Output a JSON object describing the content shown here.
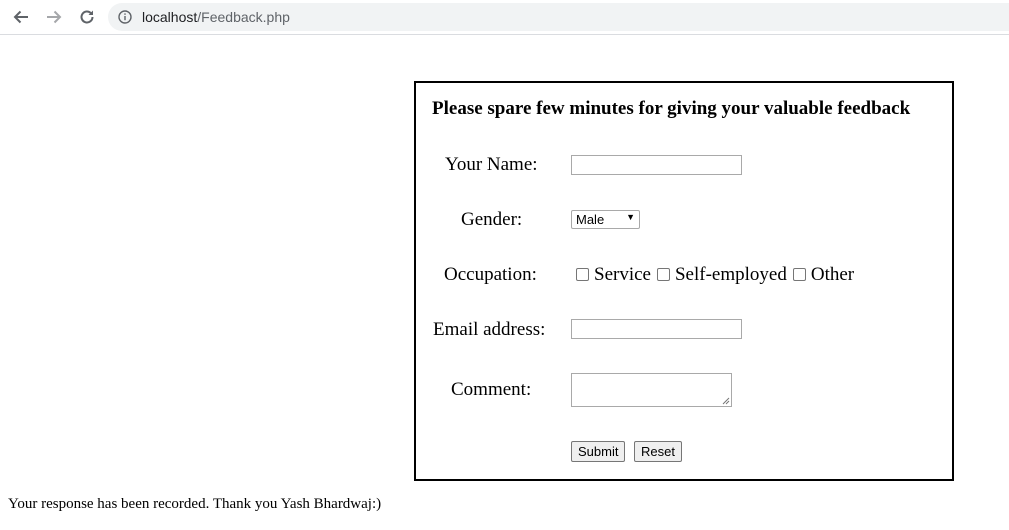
{
  "browser": {
    "url_host": "localhost",
    "url_path": "/Feedback.php",
    "icons": [
      "back-arrow-icon",
      "forward-arrow-icon",
      "reload-icon",
      "info-icon"
    ]
  },
  "form": {
    "title": "Please spare few minutes for giving your valuable feedback",
    "name_label": "Your Name:",
    "name_value": "",
    "gender_label": "Gender:",
    "gender_selected": "Male",
    "occupation_label": "Occupation:",
    "occupation_options": [
      "Service",
      "Self-employed",
      "Other"
    ],
    "email_label": "Email address:",
    "email_value": "",
    "comment_label": "Comment:",
    "comment_value": "",
    "submit_label": "Submit",
    "reset_label": "Reset"
  },
  "status": {
    "message": "Your response has been recorded. Thank you Yash Bhardwaj:)"
  },
  "colors": {
    "border": "#000000",
    "input_border": "#a9a9a9",
    "button_bg": "#efefef",
    "omnibox_bg": "#f1f3f4"
  }
}
